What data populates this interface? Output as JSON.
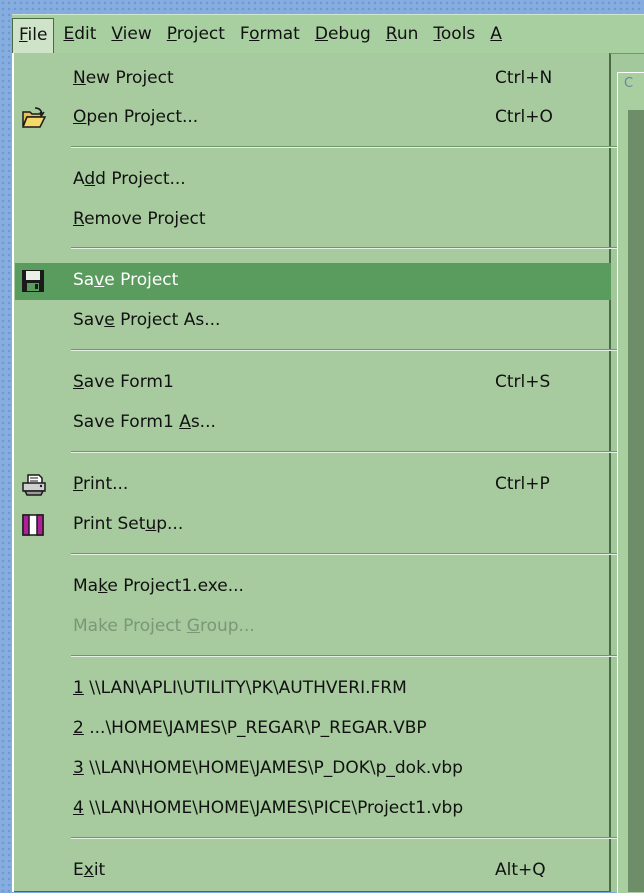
{
  "menubar": {
    "items": [
      {
        "pre": "",
        "u": "F",
        "post": "ile"
      },
      {
        "pre": "",
        "u": "E",
        "post": "dit"
      },
      {
        "pre": "",
        "u": "V",
        "post": "iew"
      },
      {
        "pre": "",
        "u": "P",
        "post": "roject"
      },
      {
        "pre": "F",
        "u": "o",
        "post": "rmat"
      },
      {
        "pre": "",
        "u": "D",
        "post": "ebug"
      },
      {
        "pre": "",
        "u": "R",
        "post": "un"
      },
      {
        "pre": "",
        "u": "T",
        "post": "ools"
      },
      {
        "pre": "",
        "u": "A",
        "post": ""
      }
    ]
  },
  "menu": {
    "items": [
      {
        "pre": "",
        "u": "N",
        "post": "ew Project",
        "shortcut": "Ctrl+N",
        "icon": ""
      },
      {
        "pre": "",
        "u": "O",
        "post": "pen Project...",
        "shortcut": "Ctrl+O",
        "icon": "open-folder-icon"
      },
      {
        "pre": "A",
        "u": "d",
        "post": "d Project...",
        "shortcut": "",
        "icon": ""
      },
      {
        "pre": "",
        "u": "R",
        "post": "emove Project",
        "shortcut": "",
        "icon": ""
      },
      {
        "pre": "Sa",
        "u": "v",
        "post": "e Project",
        "shortcut": "",
        "icon": "floppy-disk-icon"
      },
      {
        "pre": "Sav",
        "u": "e",
        "post": " Project As...",
        "shortcut": "",
        "icon": ""
      },
      {
        "pre": "",
        "u": "S",
        "post": "ave Form1",
        "shortcut": "Ctrl+S",
        "icon": ""
      },
      {
        "pre": "Save Form1 ",
        "u": "A",
        "post": "s...",
        "shortcut": "",
        "icon": ""
      },
      {
        "pre": "",
        "u": "P",
        "post": "rint...",
        "shortcut": "Ctrl+P",
        "icon": "printer-icon"
      },
      {
        "pre": "Print Set",
        "u": "u",
        "post": "p...",
        "shortcut": "",
        "icon": "print-setup-icon"
      },
      {
        "pre": "Ma",
        "u": "k",
        "post": "e Project1.exe...",
        "shortcut": "",
        "icon": ""
      },
      {
        "pre": "Make Project ",
        "u": "G",
        "post": "roup...",
        "shortcut": "",
        "icon": ""
      },
      {
        "pre": "",
        "u": "1",
        "post": " \\\\LAN\\APLI\\UTILITY\\PK\\AUTHVERI.FRM",
        "shortcut": "",
        "icon": ""
      },
      {
        "pre": "",
        "u": "2",
        "post": " ...\\HOME\\JAMES\\P_REGAR\\P_REGAR.VBP",
        "shortcut": "",
        "icon": ""
      },
      {
        "pre": "",
        "u": "3",
        "post": " \\\\LAN\\HOME\\HOME\\JAMES\\P_DOK\\p_dok.vbp",
        "shortcut": "",
        "icon": ""
      },
      {
        "pre": "",
        "u": "4",
        "post": " \\\\LAN\\HOME\\HOME\\JAMES\\PICE\\Project1.vbp",
        "shortcut": "",
        "icon": ""
      },
      {
        "pre": "E",
        "u": "x",
        "post": "it",
        "shortcut": "Alt+Q",
        "icon": ""
      }
    ]
  },
  "background_window": {
    "tab_glyph": "C"
  },
  "colors": {
    "menu_bg": "#a7cb9e",
    "highlight": "#5a9b5e",
    "disabled_text": "#7a9778",
    "desktop": "#86addf"
  }
}
